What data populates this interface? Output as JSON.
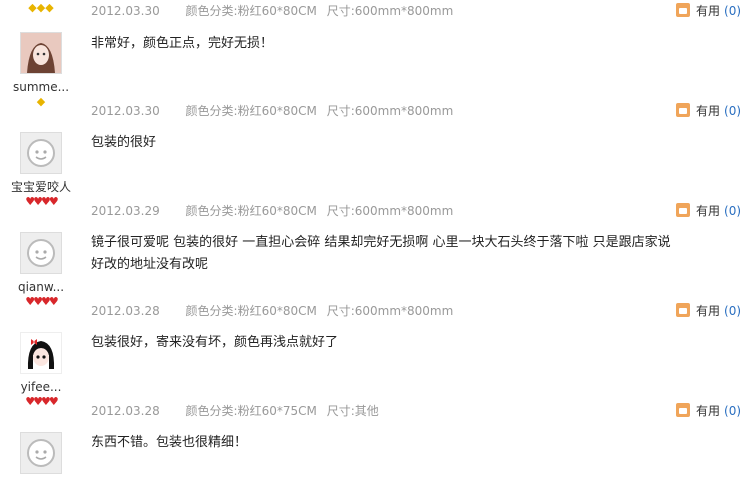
{
  "reviews": [
    {
      "id": "r0",
      "user": "",
      "rank": "◆◆◆",
      "rank_type": "gem",
      "content": "",
      "date": "2012.03.30",
      "color": "颜色分类:粉红60*80CM",
      "size": "尺寸:600mm*800mm",
      "useful_label": "有用",
      "useful_count": "(0)"
    },
    {
      "id": "r1",
      "user": "summe...",
      "rank": "◆",
      "rank_type": "gem",
      "content": "非常好，颜色正点，完好无损！",
      "date": "2012.03.30",
      "color": "颜色分类:粉红60*80CM",
      "size": "尺寸:600mm*800mm",
      "useful_label": "有用",
      "useful_count": "(0)"
    },
    {
      "id": "r2",
      "user": "宝宝爱咬人",
      "rank": "♥♥♥♥",
      "rank_type": "heart",
      "content": "包装的很好",
      "date": "2012.03.29",
      "color": "颜色分类:粉红60*80CM",
      "size": "尺寸:600mm*800mm",
      "useful_label": "有用",
      "useful_count": "(0)"
    },
    {
      "id": "r3",
      "user": "qianw...",
      "rank": "♥♥♥♥",
      "rank_type": "heart",
      "content": "镜子很可爱呢 包装的很好 一直担心会碎 结果却完好无损啊 心里一块大石头终于落下啦 只是跟店家说好改的地址没有改呢",
      "date": "2012.03.28",
      "color": "颜色分类:粉红60*80CM",
      "size": "尺寸:600mm*800mm",
      "useful_label": "有用",
      "useful_count": "(0)"
    },
    {
      "id": "r4",
      "user": "yifee...",
      "rank": "♥♥♥♥",
      "rank_type": "heart",
      "content": "包装很好，寄来没有坏，颜色再浅点就好了",
      "date": "2012.03.28",
      "color": "颜色分类:粉红60*75CM",
      "size": "尺寸:其他",
      "useful_label": "有用",
      "useful_count": "(0)"
    },
    {
      "id": "r5",
      "user": "",
      "rank": "",
      "rank_type": "heart",
      "content": "东西不错。包装也很精细！",
      "date": "",
      "color": "",
      "size": "",
      "useful_label": "",
      "useful_count": ""
    }
  ],
  "colors": {
    "link": "#2a6fc1",
    "meta": "#999999",
    "heart": "#d8272b",
    "gem": "#e8b400"
  }
}
